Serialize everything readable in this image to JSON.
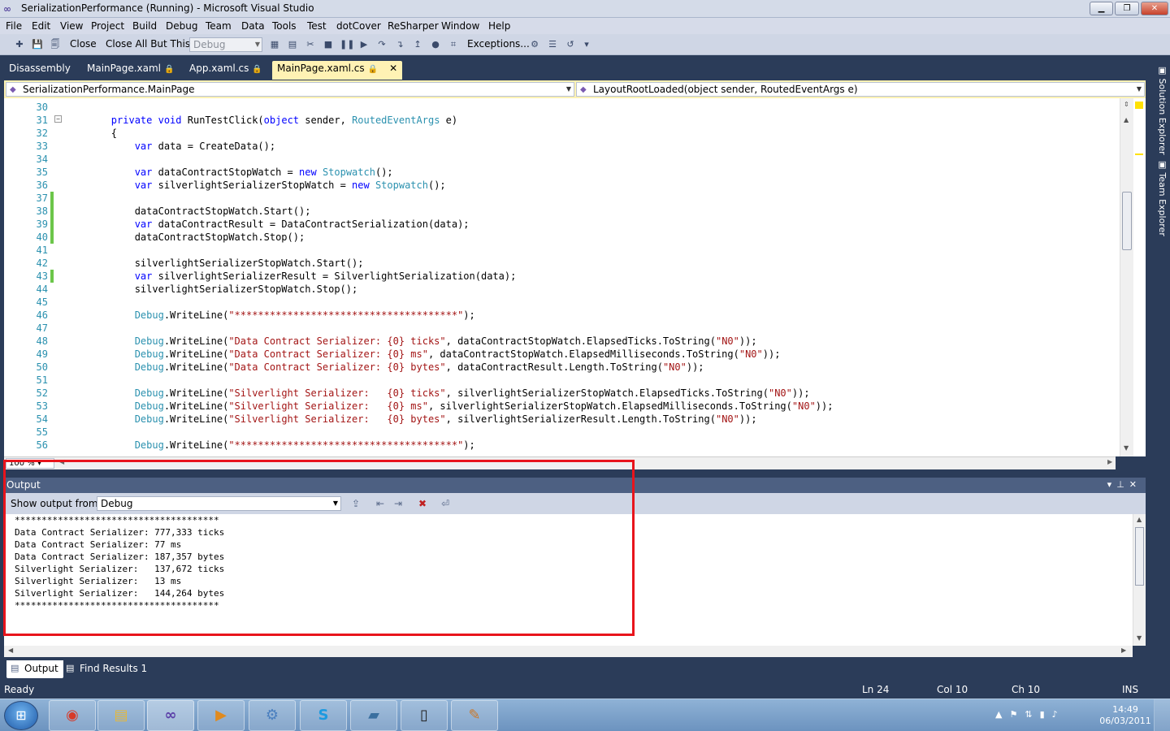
{
  "window": {
    "title": "SerializationPerformance (Running) - Microsoft Visual Studio"
  },
  "menu": [
    "File",
    "Edit",
    "View",
    "Project",
    "Build",
    "Debug",
    "Team",
    "Data",
    "Tools",
    "Test",
    "dotCover",
    "ReSharper",
    "Window",
    "Help"
  ],
  "toolbar": {
    "close_label": "Close",
    "close_all_but_this_label": "Close All But This",
    "config_value": "Debug",
    "exceptions_label": "Exceptions..."
  },
  "tabs": [
    {
      "label": "Disassembly"
    },
    {
      "label": "MainPage.xaml"
    },
    {
      "label": "App.xaml.cs"
    },
    {
      "label": "MainPage.xaml.cs"
    }
  ],
  "navbar": {
    "type_combo": "SerializationPerformance.MainPage",
    "member_combo": "LayoutRootLoaded(object sender, RoutedEventArgs e)"
  },
  "editor": {
    "zoom": "100 %",
    "lines": [
      {
        "num": "30",
        "text": ""
      },
      {
        "num": "31",
        "text": "        private void RunTestClick(object sender, RoutedEventArgs e)"
      },
      {
        "num": "32",
        "text": "        {"
      },
      {
        "num": "33",
        "text": "            var data = CreateData();"
      },
      {
        "num": "34",
        "text": ""
      },
      {
        "num": "35",
        "text": "            var dataContractStopWatch = new Stopwatch();"
      },
      {
        "num": "36",
        "text": "            var silverlightSerializerStopWatch = new Stopwatch();"
      },
      {
        "num": "37",
        "text": ""
      },
      {
        "num": "38",
        "text": "            dataContractStopWatch.Start();"
      },
      {
        "num": "39",
        "text": "            var dataContractResult = DataContractSerialization(data);"
      },
      {
        "num": "40",
        "text": "            dataContractStopWatch.Stop();"
      },
      {
        "num": "41",
        "text": ""
      },
      {
        "num": "42",
        "text": "            silverlightSerializerStopWatch.Start();"
      },
      {
        "num": "43",
        "text": "            var silverlightSerializerResult = SilverlightSerialization(data);"
      },
      {
        "num": "44",
        "text": "            silverlightSerializerStopWatch.Stop();"
      },
      {
        "num": "45",
        "text": ""
      },
      {
        "num": "46",
        "text": "            Debug.WriteLine(\"**************************************\");"
      },
      {
        "num": "47",
        "text": ""
      },
      {
        "num": "48",
        "text": "            Debug.WriteLine(\"Data Contract Serializer: {0} ticks\", dataContractStopWatch.ElapsedTicks.ToString(\"N0\"));"
      },
      {
        "num": "49",
        "text": "            Debug.WriteLine(\"Data Contract Serializer: {0} ms\", dataContractStopWatch.ElapsedMilliseconds.ToString(\"N0\"));"
      },
      {
        "num": "50",
        "text": "            Debug.WriteLine(\"Data Contract Serializer: {0} bytes\", dataContractResult.Length.ToString(\"N0\"));"
      },
      {
        "num": "51",
        "text": ""
      },
      {
        "num": "52",
        "text": "            Debug.WriteLine(\"Silverlight Serializer:   {0} ticks\", silverlightSerializerStopWatch.ElapsedTicks.ToString(\"N0\"));"
      },
      {
        "num": "53",
        "text": "            Debug.WriteLine(\"Silverlight Serializer:   {0} ms\", silverlightSerializerStopWatch.ElapsedMilliseconds.ToString(\"N0\"));"
      },
      {
        "num": "54",
        "text": "            Debug.WriteLine(\"Silverlight Serializer:   {0} bytes\", silverlightSerializerResult.Length.ToString(\"N0\"));"
      },
      {
        "num": "55",
        "text": ""
      },
      {
        "num": "56",
        "text": "            Debug.WriteLine(\"**************************************\");"
      }
    ]
  },
  "output": {
    "title": "Output",
    "show_from_label": "Show output from:",
    "source": "Debug",
    "lines": [
      "**************************************",
      "Data Contract Serializer: 777,333 ticks",
      "Data Contract Serializer: 77 ms",
      "Data Contract Serializer: 187,357 bytes",
      "Silverlight Serializer:   137,672 ticks",
      "Silverlight Serializer:   13 ms",
      "Silverlight Serializer:   144,264 bytes",
      "**************************************"
    ]
  },
  "bottom_tabs": [
    {
      "label": "Output"
    },
    {
      "label": "Find Results 1"
    }
  ],
  "status": {
    "text": "Ready",
    "ln": "Ln 24",
    "col": "Col 10",
    "ch": "Ch 10",
    "mode": "INS"
  },
  "side_tabs": [
    {
      "label": "Solution Explorer"
    },
    {
      "label": "Team Explorer"
    }
  ],
  "taskbar": {
    "time": "14:49",
    "date": "06/03/2011"
  },
  "colors": {
    "keyword": "#0000ff",
    "type": "#2b91af",
    "string": "#a31515",
    "highlight_box": "#e8141c",
    "chrome": "#2b3c59"
  }
}
